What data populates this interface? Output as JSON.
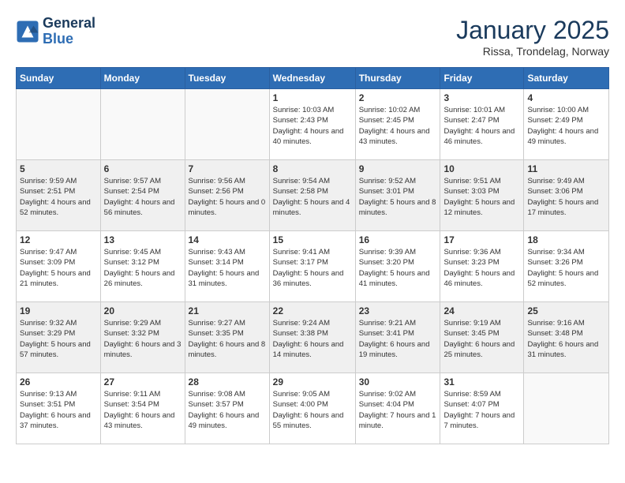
{
  "header": {
    "logo_line1": "General",
    "logo_line2": "Blue",
    "month": "January 2025",
    "location": "Rissa, Trondelag, Norway"
  },
  "weekdays": [
    "Sunday",
    "Monday",
    "Tuesday",
    "Wednesday",
    "Thursday",
    "Friday",
    "Saturday"
  ],
  "weeks": [
    [
      {
        "day": "",
        "info": ""
      },
      {
        "day": "",
        "info": ""
      },
      {
        "day": "",
        "info": ""
      },
      {
        "day": "1",
        "info": "Sunrise: 10:03 AM\nSunset: 2:43 PM\nDaylight: 4 hours and 40 minutes."
      },
      {
        "day": "2",
        "info": "Sunrise: 10:02 AM\nSunset: 2:45 PM\nDaylight: 4 hours and 43 minutes."
      },
      {
        "day": "3",
        "info": "Sunrise: 10:01 AM\nSunset: 2:47 PM\nDaylight: 4 hours and 46 minutes."
      },
      {
        "day": "4",
        "info": "Sunrise: 10:00 AM\nSunset: 2:49 PM\nDaylight: 4 hours and 49 minutes."
      }
    ],
    [
      {
        "day": "5",
        "info": "Sunrise: 9:59 AM\nSunset: 2:51 PM\nDaylight: 4 hours and 52 minutes."
      },
      {
        "day": "6",
        "info": "Sunrise: 9:57 AM\nSunset: 2:54 PM\nDaylight: 4 hours and 56 minutes."
      },
      {
        "day": "7",
        "info": "Sunrise: 9:56 AM\nSunset: 2:56 PM\nDaylight: 5 hours and 0 minutes."
      },
      {
        "day": "8",
        "info": "Sunrise: 9:54 AM\nSunset: 2:58 PM\nDaylight: 5 hours and 4 minutes."
      },
      {
        "day": "9",
        "info": "Sunrise: 9:52 AM\nSunset: 3:01 PM\nDaylight: 5 hours and 8 minutes."
      },
      {
        "day": "10",
        "info": "Sunrise: 9:51 AM\nSunset: 3:03 PM\nDaylight: 5 hours and 12 minutes."
      },
      {
        "day": "11",
        "info": "Sunrise: 9:49 AM\nSunset: 3:06 PM\nDaylight: 5 hours and 17 minutes."
      }
    ],
    [
      {
        "day": "12",
        "info": "Sunrise: 9:47 AM\nSunset: 3:09 PM\nDaylight: 5 hours and 21 minutes."
      },
      {
        "day": "13",
        "info": "Sunrise: 9:45 AM\nSunset: 3:12 PM\nDaylight: 5 hours and 26 minutes."
      },
      {
        "day": "14",
        "info": "Sunrise: 9:43 AM\nSunset: 3:14 PM\nDaylight: 5 hours and 31 minutes."
      },
      {
        "day": "15",
        "info": "Sunrise: 9:41 AM\nSunset: 3:17 PM\nDaylight: 5 hours and 36 minutes."
      },
      {
        "day": "16",
        "info": "Sunrise: 9:39 AM\nSunset: 3:20 PM\nDaylight: 5 hours and 41 minutes."
      },
      {
        "day": "17",
        "info": "Sunrise: 9:36 AM\nSunset: 3:23 PM\nDaylight: 5 hours and 46 minutes."
      },
      {
        "day": "18",
        "info": "Sunrise: 9:34 AM\nSunset: 3:26 PM\nDaylight: 5 hours and 52 minutes."
      }
    ],
    [
      {
        "day": "19",
        "info": "Sunrise: 9:32 AM\nSunset: 3:29 PM\nDaylight: 5 hours and 57 minutes."
      },
      {
        "day": "20",
        "info": "Sunrise: 9:29 AM\nSunset: 3:32 PM\nDaylight: 6 hours and 3 minutes."
      },
      {
        "day": "21",
        "info": "Sunrise: 9:27 AM\nSunset: 3:35 PM\nDaylight: 6 hours and 8 minutes."
      },
      {
        "day": "22",
        "info": "Sunrise: 9:24 AM\nSunset: 3:38 PM\nDaylight: 6 hours and 14 minutes."
      },
      {
        "day": "23",
        "info": "Sunrise: 9:21 AM\nSunset: 3:41 PM\nDaylight: 6 hours and 19 minutes."
      },
      {
        "day": "24",
        "info": "Sunrise: 9:19 AM\nSunset: 3:45 PM\nDaylight: 6 hours and 25 minutes."
      },
      {
        "day": "25",
        "info": "Sunrise: 9:16 AM\nSunset: 3:48 PM\nDaylight: 6 hours and 31 minutes."
      }
    ],
    [
      {
        "day": "26",
        "info": "Sunrise: 9:13 AM\nSunset: 3:51 PM\nDaylight: 6 hours and 37 minutes."
      },
      {
        "day": "27",
        "info": "Sunrise: 9:11 AM\nSunset: 3:54 PM\nDaylight: 6 hours and 43 minutes."
      },
      {
        "day": "28",
        "info": "Sunrise: 9:08 AM\nSunset: 3:57 PM\nDaylight: 6 hours and 49 minutes."
      },
      {
        "day": "29",
        "info": "Sunrise: 9:05 AM\nSunset: 4:00 PM\nDaylight: 6 hours and 55 minutes."
      },
      {
        "day": "30",
        "info": "Sunrise: 9:02 AM\nSunset: 4:04 PM\nDaylight: 7 hours and 1 minute."
      },
      {
        "day": "31",
        "info": "Sunrise: 8:59 AM\nSunset: 4:07 PM\nDaylight: 7 hours and 7 minutes."
      },
      {
        "day": "",
        "info": ""
      }
    ]
  ]
}
